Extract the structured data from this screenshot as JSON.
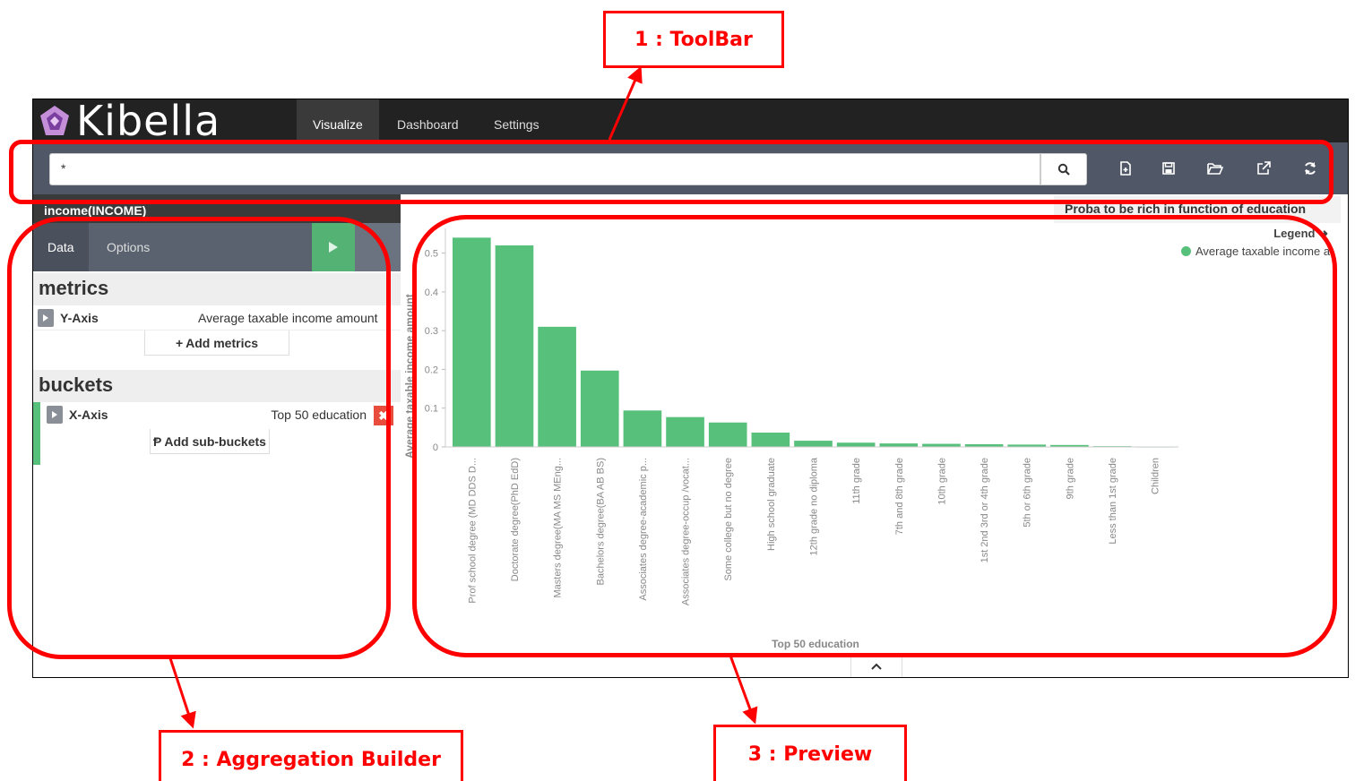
{
  "brand": {
    "name": "Kibella"
  },
  "nav": {
    "tabs": [
      {
        "label": "Visualize",
        "active": true
      },
      {
        "label": "Dashboard",
        "active": false
      },
      {
        "label": "Settings",
        "active": false
      }
    ]
  },
  "toolbar": {
    "query_value": "*",
    "icons": [
      "search-icon",
      "new-document-icon",
      "save-icon",
      "open-folder-icon",
      "share-icon",
      "refresh-icon"
    ]
  },
  "sidebar": {
    "index_title": "income(INCOME)",
    "tabs": [
      {
        "label": "Data",
        "active": true
      },
      {
        "label": "Options",
        "active": false
      }
    ],
    "metrics": {
      "header": "metrics",
      "items": [
        {
          "label": "Y-Axis",
          "value": "Average taxable income amount"
        }
      ],
      "add_label": "Add metrics"
    },
    "buckets": {
      "header": "buckets",
      "items": [
        {
          "label": "X-Axis",
          "value": "Top 50 education"
        }
      ],
      "add_label": "Add sub-buckets"
    }
  },
  "preview": {
    "title": "Proba to be rich in function of education",
    "legend_label": "Legend",
    "legend_items": [
      "Average taxable income amount"
    ],
    "bar_color": "#57c17b"
  },
  "chart_data": {
    "type": "bar",
    "title": "",
    "xlabel": "Top 50 education",
    "ylabel": "Average taxable income amount",
    "ylim": [
      0,
      0.55
    ],
    "yticks": [
      0,
      0.1,
      0.2,
      0.3,
      0.4,
      0.5
    ],
    "categories": [
      "Prof school degree (MD DDS D...",
      "Doctorate degree(PhD EdD)",
      "Masters degree(MA MS MEng...",
      "Bachelors degree(BA AB BS)",
      "Associates degree-academic p...",
      "Associates degree-occup /vocat...",
      "Some college but no degree",
      "High school graduate",
      "12th grade no diploma",
      "11th grade",
      "7th and 8th grade",
      "10th grade",
      "1st 2nd 3rd or 4th grade",
      "5th or 6th grade",
      "9th grade",
      "Less than 1st grade",
      "Children"
    ],
    "series": [
      {
        "name": "Average taxable income amount",
        "values": [
          0.54,
          0.52,
          0.31,
          0.197,
          0.094,
          0.077,
          0.063,
          0.037,
          0.016,
          0.011,
          0.009,
          0.008,
          0.007,
          0.006,
          0.005,
          0.002,
          0.001
        ]
      }
    ]
  },
  "annotations": [
    {
      "label": "1 : ToolBar"
    },
    {
      "label": "2 : Aggregation Builder"
    },
    {
      "label": "3 : Preview"
    }
  ]
}
